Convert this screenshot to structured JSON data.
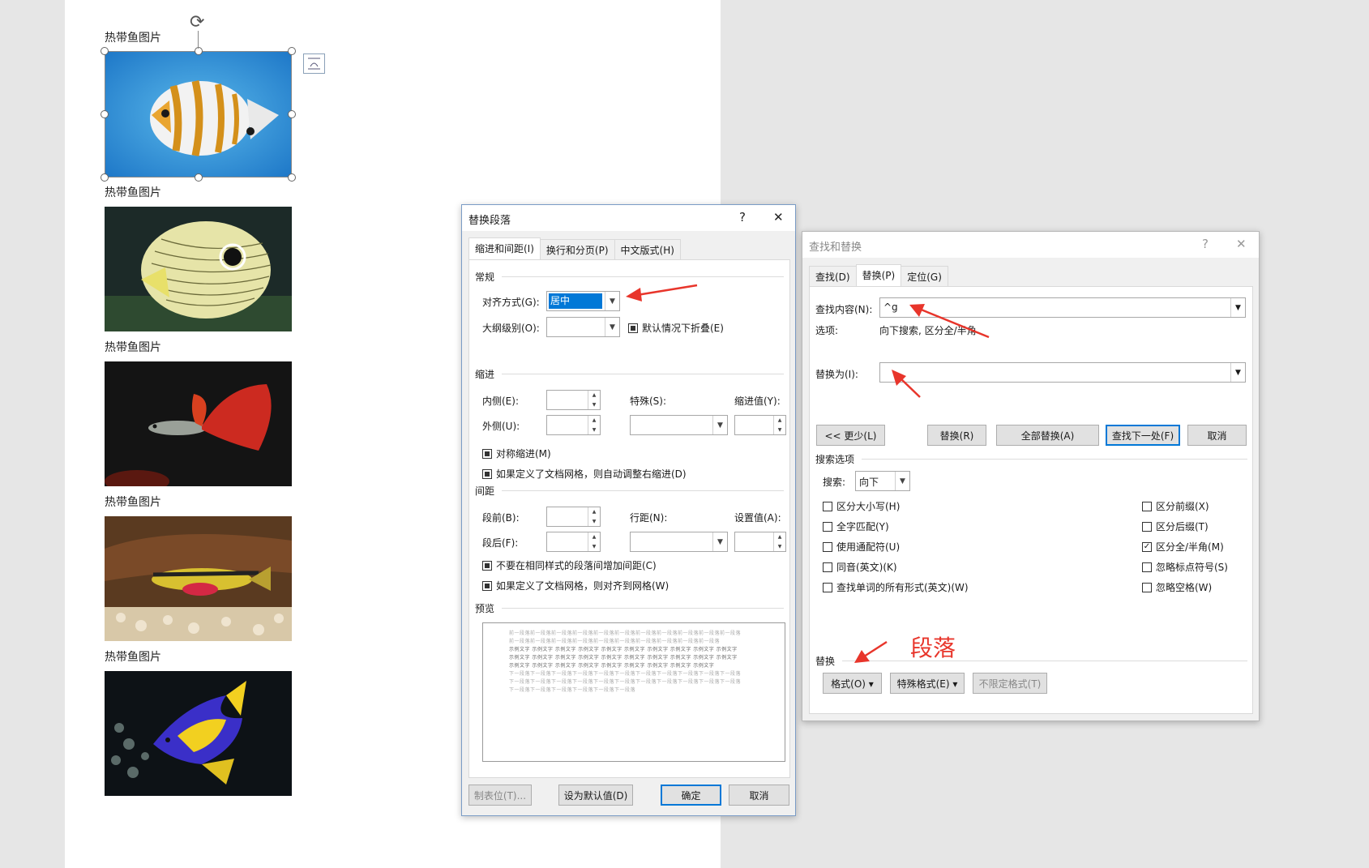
{
  "document": {
    "captions": [
      "热带鱼图片",
      "热带鱼图片",
      "热带鱼图片",
      "热带鱼图片",
      "热带鱼图片"
    ],
    "images": [
      "butterflyfish-photo",
      "four-eye-butterflyfish-photo",
      "guppy-photo",
      "kribensis-cichlid-photo",
      "queen-angelfish-photo"
    ]
  },
  "para_dialog": {
    "title": "替换段落",
    "help": "?",
    "close": "✕",
    "tabs": [
      "缩进和间距(I)",
      "换行和分页(P)",
      "中文版式(H)"
    ],
    "sections": {
      "general": "常规",
      "indent": "缩进",
      "spacing": "间距",
      "preview": "预览"
    },
    "labels": {
      "alignment": "对齐方式(G):",
      "outline": "大纲级别(O):",
      "collapse": "默认情况下折叠(E)",
      "inside": "内侧(E):",
      "outside": "外侧(U):",
      "special": "特殊(S):",
      "indent_value": "缩进值(Y):",
      "mirror": "对称缩进(M)",
      "auto_right": "如果定义了文档网格，则自动调整右缩进(D)",
      "before": "段前(B):",
      "after": "段后(F):",
      "line_spacing": "行距(N):",
      "set_value": "设置值(A):",
      "no_space": "不要在相同样式的段落间增加间距(C)",
      "snap_grid": "如果定义了文档网格，则对齐到网格(W)"
    },
    "alignment_value": "居中",
    "preview_before": "前一段落前一段落前一段落前一段落前一段落前一段落前一段落前一段落前一段落前一段落前一段落前一段落前一段落前一段落前一段落前一段落前一段落前一段落前一段落前一段落前一段落",
    "preview_sample": "示例文字 示例文字 示例文字 示例文字 示例文字 示例文字 示例文字 示例文字 示例文字 示例文字 示例文字 示例文字 示例文字 示例文字 示例文字 示例文字 示例文字 示例文字 示例文字 示例文字 示例文字 示例文字 示例文字 示例文字 示例文字 示例文字 示例文字 示例文字 示例文字",
    "preview_after": "下一段落下一段落下一段落下一段落下一段落下一段落下一段落下一段落下一段落下一段落下一段落下一段落下一段落下一段落下一段落下一段落下一段落下一段落下一段落下一段落下一段落下一段落下一段落下一段落下一段落下一段落下一段落下一段落",
    "buttons": {
      "tabs": "制表位(T)...",
      "set_default": "设为默认值(D)",
      "ok": "确定",
      "cancel": "取消"
    }
  },
  "find_dialog": {
    "title": "查找和替换",
    "help": "?",
    "close": "✕",
    "tabs": [
      "查找(D)",
      "替换(P)",
      "定位(G)"
    ],
    "find_label": "查找内容(N):",
    "find_value": "^g",
    "options_label": "选项:",
    "options_value": "向下搜索, 区分全/半角",
    "replace_label": "替换为(I):",
    "replace_value": "",
    "buttons": {
      "less": "<< 更少(L)",
      "replace": "替换(R)",
      "replace_all": "全部替换(A)",
      "find_next": "查找下一处(F)",
      "cancel": "取消"
    },
    "search_options_title": "搜索选项",
    "search_label": "搜索:",
    "search_value": "向下",
    "left_options": [
      "区分大小写(H)",
      "全字匹配(Y)",
      "使用通配符(U)",
      "同音(英文)(K)",
      "查找单词的所有形式(英文)(W)"
    ],
    "right_options": [
      "区分前缀(X)",
      "区分后缀(T)",
      "区分全/半角(M)",
      "忽略标点符号(S)",
      "忽略空格(W)"
    ],
    "right_checked": [
      false,
      false,
      true,
      false,
      false
    ],
    "replace_section": "替换",
    "format_btn": "格式(O) ▾",
    "special_btn": "特殊格式(E) ▾",
    "no_format_btn": "不限定格式(T)"
  },
  "annotation": {
    "text": "段落",
    "color": "#e8352b"
  },
  "colors": {
    "accent": "#0078d7",
    "dialog_border": "#7a9cc6",
    "selection": "#0078d7"
  }
}
